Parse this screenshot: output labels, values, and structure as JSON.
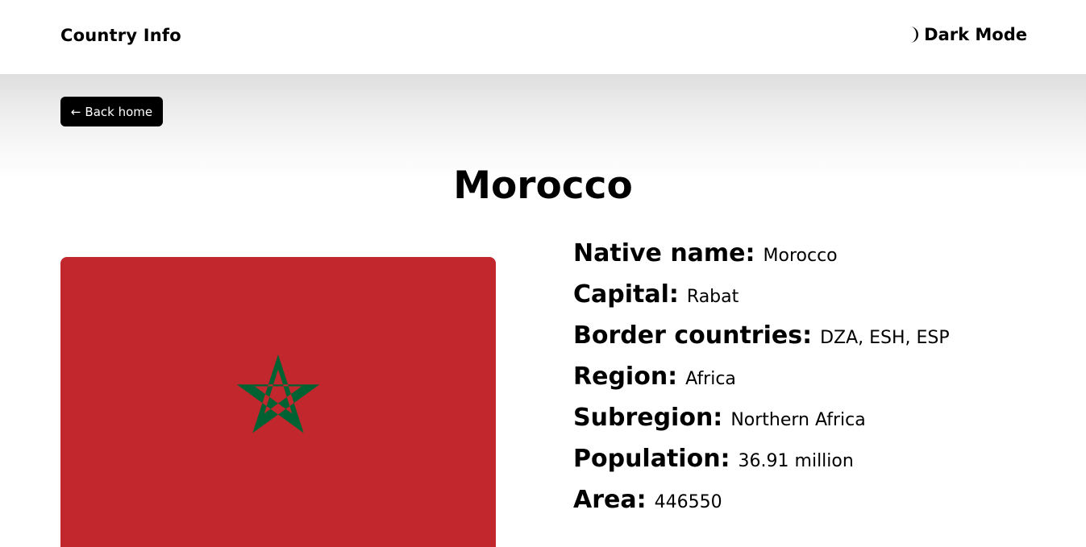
{
  "header": {
    "brand": "Country Info",
    "mode_toggle_label": "Dark Mode",
    "mode_icon": "moon-icon"
  },
  "nav": {
    "back_arrow": "←",
    "back_label": "Back home"
  },
  "country": {
    "name": "Morocco",
    "flag": {
      "background_color": "#c1272d",
      "star_color": "#006233",
      "emblem": "pentagram-star"
    },
    "details": [
      {
        "label": "Native name:",
        "value": "Morocco"
      },
      {
        "label": "Capital:",
        "value": "Rabat"
      },
      {
        "label": "Border countries:",
        "value": "DZA, ESH, ESP"
      },
      {
        "label": "Region:",
        "value": "Africa"
      },
      {
        "label": "Subregion:",
        "value": "Northern Africa"
      },
      {
        "label": "Population:",
        "value": "36.91 million"
      },
      {
        "label": "Area:",
        "value": "446550"
      }
    ]
  },
  "colors": {
    "button_bg": "#000000",
    "button_text": "#ffffff",
    "page_bg": "#ffffff"
  }
}
